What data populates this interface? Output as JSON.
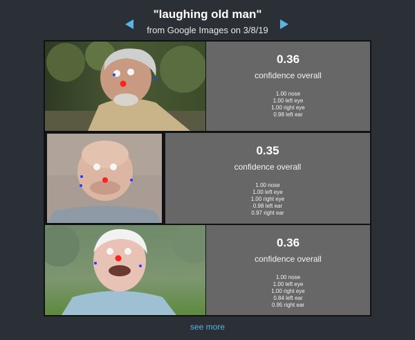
{
  "header": {
    "title": "\"laughing old man\"",
    "subtitle": "from Google Images on 3/8/19",
    "prev_icon": "triangle-left-icon",
    "next_icon": "triangle-right-icon"
  },
  "colors": {
    "background": "#2b2f36",
    "panel": "#676767",
    "accent": "#5ab4e3",
    "nose_marker": "#ff2020",
    "feature_marker": "#2a3cff"
  },
  "results": [
    {
      "score": "0.36",
      "confidence_label": "confidence overall",
      "parts": [
        "1.00 nose",
        "1.00 left eye",
        "1.00 right eye",
        "0.98 left ear"
      ]
    },
    {
      "score": "0.35",
      "confidence_label": "confidence overall",
      "parts": [
        "1.00 nose",
        "1.00 left eye",
        "1.00 right eye",
        "0.98 left ear",
        "0.97 right ear"
      ]
    },
    {
      "score": "0.36",
      "confidence_label": "confidence overall",
      "parts": [
        "1.00 nose",
        "1.00 left eye",
        "1.00 right eye",
        "0.84 left ear",
        "0.95 right ear"
      ]
    }
  ],
  "footer": {
    "see_more": "see more"
  }
}
